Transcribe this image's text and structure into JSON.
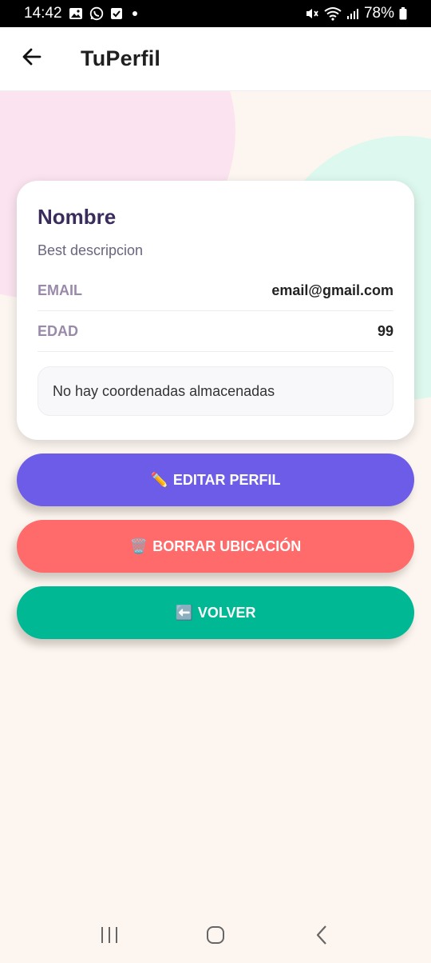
{
  "status_bar": {
    "time": "14:42",
    "battery": "78%",
    "left_icons": [
      "gallery-icon",
      "whatsapp-icon",
      "checkbox-icon",
      "dot-icon"
    ],
    "right_icons": [
      "mute-icon",
      "wifi-icon",
      "signal-icon",
      "battery-icon"
    ]
  },
  "app_bar": {
    "title": "TuPerfil",
    "back_icon": "arrow-left-icon"
  },
  "profile": {
    "name": "Nombre",
    "description": "Best descripcion",
    "rows": [
      {
        "label": "EMAIL",
        "value": "email@gmail.com"
      },
      {
        "label": "EDAD",
        "value": "99"
      }
    ],
    "coords_text": "No hay coordenadas almacenadas"
  },
  "buttons": {
    "edit": {
      "emoji": "✏️",
      "label": "EDITAR PERFIL",
      "color": "#6c5ce7"
    },
    "delete": {
      "emoji": "🗑️",
      "label": "BORRAR UBICACIÓN",
      "color": "#ff6b6b"
    },
    "back": {
      "emoji": "⬅️",
      "label": "VOLVER",
      "color": "#00b894"
    }
  },
  "nav_bar": {
    "icons": [
      "recent-apps-icon",
      "home-icon",
      "back-icon"
    ]
  },
  "colors": {
    "background": "#fdf6f0",
    "blob_pink": "#fbe3ef",
    "blob_mint": "#ddf8ee",
    "title_text": "#3a2d5c"
  }
}
